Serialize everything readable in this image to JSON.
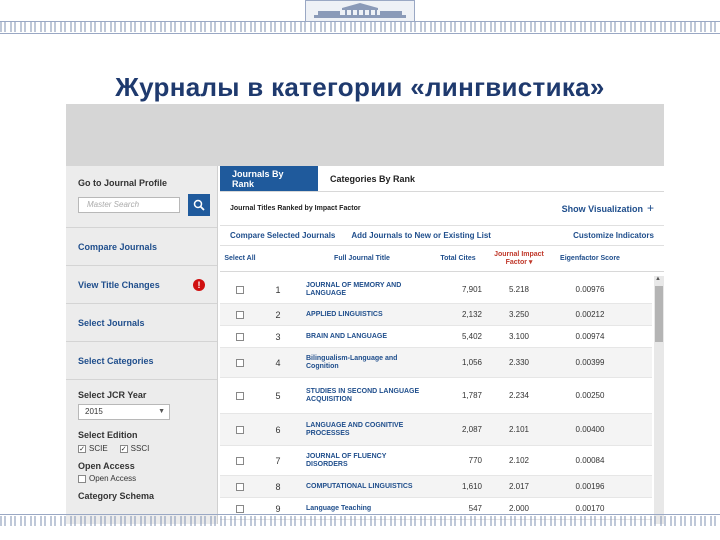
{
  "slide": {
    "title": "Журналы в категории «лингвистика»"
  },
  "left_panel": {
    "profile_heading": "Go to Journal Profile",
    "search_placeholder": "Master Search",
    "compare_journals": "Compare Journals",
    "view_title_changes": "View Title Changes",
    "alert_mark": "!",
    "select_journals": "Select Journals",
    "select_categories": "Select Categories",
    "jcr_year_heading": "Select JCR Year",
    "jcr_year_value": "2015",
    "edition_heading": "Select Edition",
    "edition_options": [
      {
        "label": "SCIE",
        "checked": true
      },
      {
        "label": "SSCI",
        "checked": true
      }
    ],
    "open_access_heading": "Open Access",
    "open_access_option": "Open Access",
    "category_schema_heading": "Category Schema"
  },
  "tabs": [
    {
      "label": "Journals By Rank",
      "active": true
    },
    {
      "label": "Categories By Rank",
      "active": false
    }
  ],
  "toolbar": {
    "caption": "Journal Titles Ranked by Impact Factor",
    "show_visualization": "Show Visualization",
    "plus": "+",
    "compare_selected": "Compare Selected Journals",
    "add_journals": "Add Journals to New or Existing List",
    "customize": "Customize Indicators"
  },
  "table": {
    "headers": {
      "select": "Select All",
      "title": "Full Journal Title",
      "cites": "Total Cites",
      "jif": "Journal Impact Factor",
      "eigen": "Eigenfactor Score"
    },
    "rows": [
      {
        "rank": "1",
        "title": "JOURNAL OF MEMORY AND LANGUAGE",
        "cites": "7,901",
        "jif": "5.218",
        "eigen": "0.00976"
      },
      {
        "rank": "2",
        "title": "APPLIED LINGUISTICS",
        "cites": "2,132",
        "jif": "3.250",
        "eigen": "0.00212"
      },
      {
        "rank": "3",
        "title": "BRAIN AND LANGUAGE",
        "cites": "5,402",
        "jif": "3.100",
        "eigen": "0.00974"
      },
      {
        "rank": "4",
        "title": "Bilingualism-Language and Cognition",
        "cites": "1,056",
        "jif": "2.330",
        "eigen": "0.00399"
      },
      {
        "rank": "5",
        "title": "STUDIES IN SECOND LANGUAGE ACQUISITION",
        "cites": "1,787",
        "jif": "2.234",
        "eigen": "0.00250"
      },
      {
        "rank": "6",
        "title": "LANGUAGE AND COGNITIVE PROCESSES",
        "cites": "2,087",
        "jif": "2.101",
        "eigen": "0.00400"
      },
      {
        "rank": "7",
        "title": "JOURNAL OF FLUENCY DISORDERS",
        "cites": "770",
        "jif": "2.102",
        "eigen": "0.00084"
      },
      {
        "rank": "8",
        "title": "COMPUTATIONAL LINGUISTICS",
        "cites": "1,610",
        "jif": "2.017",
        "eigen": "0.00196"
      },
      {
        "rank": "9",
        "title": "Language Teaching",
        "cites": "547",
        "jif": "2.000",
        "eigen": "0.00170"
      }
    ]
  },
  "colors": {
    "accent": "#1f5a9c",
    "title": "#1f3a6e",
    "link": "#1f4e8c",
    "sorted_header": "#c0392b"
  }
}
